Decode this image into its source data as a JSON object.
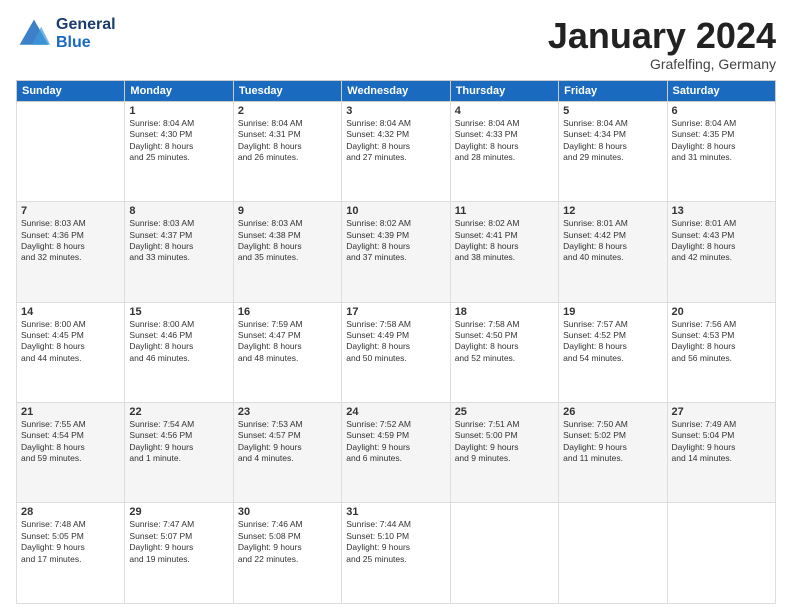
{
  "logo": {
    "line1": "General",
    "line2": "Blue"
  },
  "title": "January 2024",
  "subtitle": "Grafelfing, Germany",
  "days_of_week": [
    "Sunday",
    "Monday",
    "Tuesday",
    "Wednesday",
    "Thursday",
    "Friday",
    "Saturday"
  ],
  "weeks": [
    [
      {
        "day": "",
        "info": ""
      },
      {
        "day": "1",
        "info": "Sunrise: 8:04 AM\nSunset: 4:30 PM\nDaylight: 8 hours\nand 25 minutes."
      },
      {
        "day": "2",
        "info": "Sunrise: 8:04 AM\nSunset: 4:31 PM\nDaylight: 8 hours\nand 26 minutes."
      },
      {
        "day": "3",
        "info": "Sunrise: 8:04 AM\nSunset: 4:32 PM\nDaylight: 8 hours\nand 27 minutes."
      },
      {
        "day": "4",
        "info": "Sunrise: 8:04 AM\nSunset: 4:33 PM\nDaylight: 8 hours\nand 28 minutes."
      },
      {
        "day": "5",
        "info": "Sunrise: 8:04 AM\nSunset: 4:34 PM\nDaylight: 8 hours\nand 29 minutes."
      },
      {
        "day": "6",
        "info": "Sunrise: 8:04 AM\nSunset: 4:35 PM\nDaylight: 8 hours\nand 31 minutes."
      }
    ],
    [
      {
        "day": "7",
        "info": "Sunrise: 8:03 AM\nSunset: 4:36 PM\nDaylight: 8 hours\nand 32 minutes."
      },
      {
        "day": "8",
        "info": "Sunrise: 8:03 AM\nSunset: 4:37 PM\nDaylight: 8 hours\nand 33 minutes."
      },
      {
        "day": "9",
        "info": "Sunrise: 8:03 AM\nSunset: 4:38 PM\nDaylight: 8 hours\nand 35 minutes."
      },
      {
        "day": "10",
        "info": "Sunrise: 8:02 AM\nSunset: 4:39 PM\nDaylight: 8 hours\nand 37 minutes."
      },
      {
        "day": "11",
        "info": "Sunrise: 8:02 AM\nSunset: 4:41 PM\nDaylight: 8 hours\nand 38 minutes."
      },
      {
        "day": "12",
        "info": "Sunrise: 8:01 AM\nSunset: 4:42 PM\nDaylight: 8 hours\nand 40 minutes."
      },
      {
        "day": "13",
        "info": "Sunrise: 8:01 AM\nSunset: 4:43 PM\nDaylight: 8 hours\nand 42 minutes."
      }
    ],
    [
      {
        "day": "14",
        "info": "Sunrise: 8:00 AM\nSunset: 4:45 PM\nDaylight: 8 hours\nand 44 minutes."
      },
      {
        "day": "15",
        "info": "Sunrise: 8:00 AM\nSunset: 4:46 PM\nDaylight: 8 hours\nand 46 minutes."
      },
      {
        "day": "16",
        "info": "Sunrise: 7:59 AM\nSunset: 4:47 PM\nDaylight: 8 hours\nand 48 minutes."
      },
      {
        "day": "17",
        "info": "Sunrise: 7:58 AM\nSunset: 4:49 PM\nDaylight: 8 hours\nand 50 minutes."
      },
      {
        "day": "18",
        "info": "Sunrise: 7:58 AM\nSunset: 4:50 PM\nDaylight: 8 hours\nand 52 minutes."
      },
      {
        "day": "19",
        "info": "Sunrise: 7:57 AM\nSunset: 4:52 PM\nDaylight: 8 hours\nand 54 minutes."
      },
      {
        "day": "20",
        "info": "Sunrise: 7:56 AM\nSunset: 4:53 PM\nDaylight: 8 hours\nand 56 minutes."
      }
    ],
    [
      {
        "day": "21",
        "info": "Sunrise: 7:55 AM\nSunset: 4:54 PM\nDaylight: 8 hours\nand 59 minutes."
      },
      {
        "day": "22",
        "info": "Sunrise: 7:54 AM\nSunset: 4:56 PM\nDaylight: 9 hours\nand 1 minute."
      },
      {
        "day": "23",
        "info": "Sunrise: 7:53 AM\nSunset: 4:57 PM\nDaylight: 9 hours\nand 4 minutes."
      },
      {
        "day": "24",
        "info": "Sunrise: 7:52 AM\nSunset: 4:59 PM\nDaylight: 9 hours\nand 6 minutes."
      },
      {
        "day": "25",
        "info": "Sunrise: 7:51 AM\nSunset: 5:00 PM\nDaylight: 9 hours\nand 9 minutes."
      },
      {
        "day": "26",
        "info": "Sunrise: 7:50 AM\nSunset: 5:02 PM\nDaylight: 9 hours\nand 11 minutes."
      },
      {
        "day": "27",
        "info": "Sunrise: 7:49 AM\nSunset: 5:04 PM\nDaylight: 9 hours\nand 14 minutes."
      }
    ],
    [
      {
        "day": "28",
        "info": "Sunrise: 7:48 AM\nSunset: 5:05 PM\nDaylight: 9 hours\nand 17 minutes."
      },
      {
        "day": "29",
        "info": "Sunrise: 7:47 AM\nSunset: 5:07 PM\nDaylight: 9 hours\nand 19 minutes."
      },
      {
        "day": "30",
        "info": "Sunrise: 7:46 AM\nSunset: 5:08 PM\nDaylight: 9 hours\nand 22 minutes."
      },
      {
        "day": "31",
        "info": "Sunrise: 7:44 AM\nSunset: 5:10 PM\nDaylight: 9 hours\nand 25 minutes."
      },
      {
        "day": "",
        "info": ""
      },
      {
        "day": "",
        "info": ""
      },
      {
        "day": "",
        "info": ""
      }
    ]
  ]
}
